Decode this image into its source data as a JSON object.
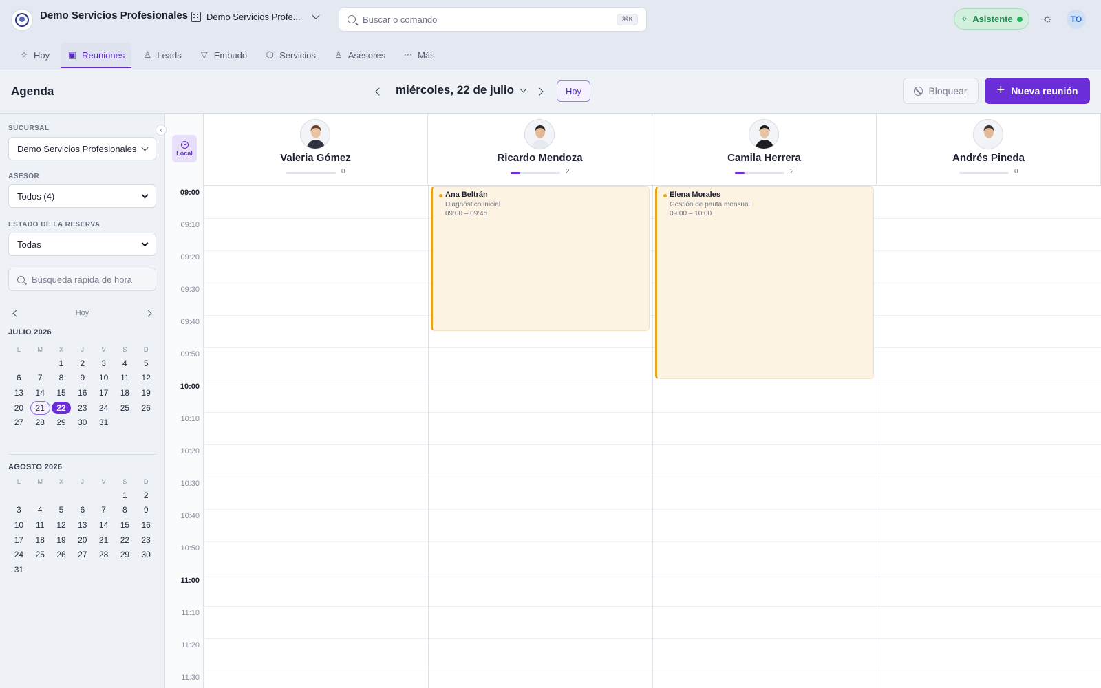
{
  "app": {
    "title": "Demo Servicios Profesionales",
    "branch_switch": "Demo Servicios Profe..."
  },
  "search": {
    "placeholder": "Buscar o comando",
    "shortcut": "⌘K"
  },
  "assistant": {
    "label": "Asistente",
    "status_color": "#22b35a"
  },
  "user": {
    "initials": "TO"
  },
  "tabs": [
    {
      "label": "Hoy",
      "icon": "sparkles-icon",
      "active": false
    },
    {
      "label": "Reuniones",
      "icon": "calendar-icon",
      "active": true
    },
    {
      "label": "Leads",
      "icon": "users-icon",
      "active": false
    },
    {
      "label": "Embudo",
      "icon": "funnel-icon",
      "active": false
    },
    {
      "label": "Servicios",
      "icon": "box-icon",
      "active": false
    },
    {
      "label": "Asesores",
      "icon": "user-cog-icon",
      "active": false
    },
    {
      "label": "Más",
      "icon": "more-icon",
      "active": false
    }
  ],
  "header": {
    "title": "Agenda",
    "date": "miércoles, 22 de julio",
    "today_button": "Hoy",
    "block_button": "Bloquear",
    "new_button": "Nueva reunión"
  },
  "sidebar": {
    "branch_label": "SUCURSAL",
    "branch_value": "Demo Servicios Profesionales",
    "advisor_label": "ASESOR",
    "advisor_value": "Todos (4)",
    "status_label": "ESTADO DE LA RESERVA",
    "status_value": "Todas",
    "quick_search_placeholder": "Búsqueda rápida de hora",
    "mini_today": "Hoy",
    "weekdays": [
      "L",
      "M",
      "X",
      "J",
      "V",
      "S",
      "D"
    ],
    "months": [
      {
        "title": "JULIO 2026",
        "offset": 2,
        "days": 31,
        "today": 21,
        "selected": 22
      },
      {
        "title": "AGOSTO 2026",
        "offset": 5,
        "days": 31,
        "today": null,
        "selected": null
      }
    ]
  },
  "calendar": {
    "timezone_label": "Local",
    "advisors": [
      {
        "name": "Valeria Gómez",
        "count": "0",
        "load": 0
      },
      {
        "name": "Ricardo Mendoza",
        "count": "2",
        "load": 0.2
      },
      {
        "name": "Camila Herrera",
        "count": "2",
        "load": 0.2
      },
      {
        "name": "Andrés Pineda",
        "count": "0",
        "load": 0
      }
    ],
    "time_slots": [
      "09:00",
      "09:10",
      "09:20",
      "09:30",
      "09:40",
      "09:50",
      "10:00",
      "10:10",
      "10:20",
      "10:30",
      "10:40",
      "10:50",
      "11:00",
      "11:10",
      "11:20",
      "11:30"
    ],
    "events": [
      {
        "advisor": 1,
        "client": "Ana Beltrán",
        "service": "Diagnóstico inicial",
        "time": "09:00 – 09:45",
        "start_min": 0,
        "end_min": 45,
        "color": "#e9a21b"
      },
      {
        "advisor": 2,
        "client": "Elena Morales",
        "service": "Gestión de pauta mensual",
        "time": "09:00 – 10:00",
        "start_min": 0,
        "end_min": 60,
        "color": "#e9a21b"
      }
    ]
  },
  "colors": {
    "accent": "#6a2dd8",
    "event_border": "#e9a21b",
    "event_bg": "#fdf3e3"
  }
}
